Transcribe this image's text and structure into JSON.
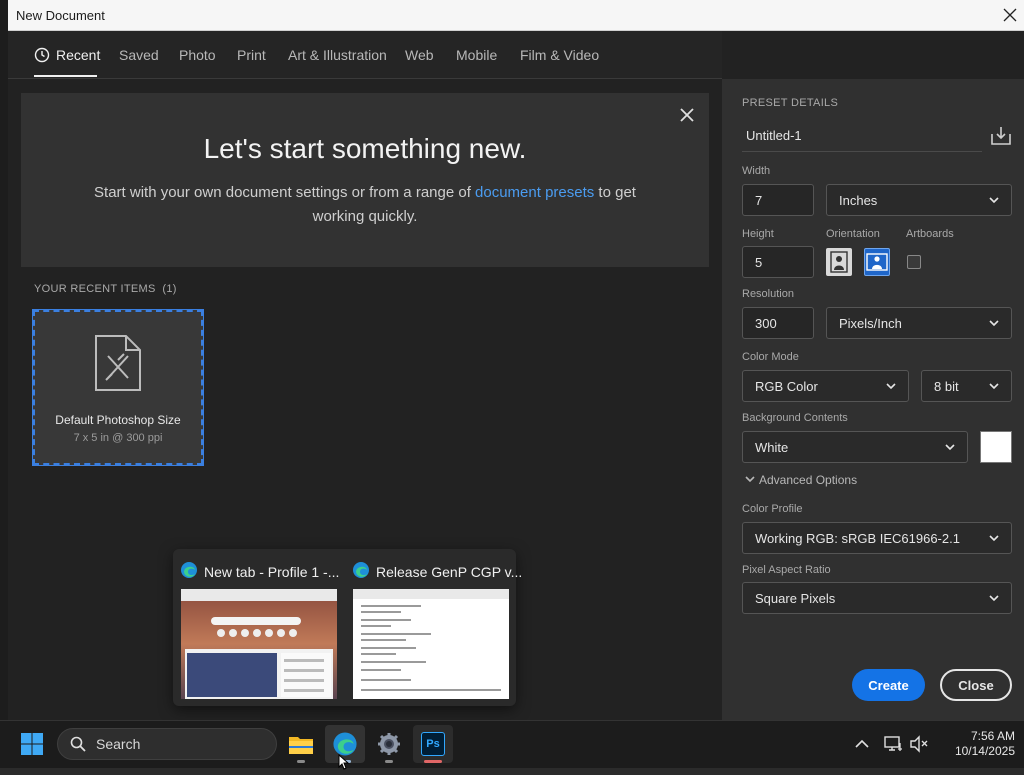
{
  "window": {
    "title": "New Document"
  },
  "tabs": [
    {
      "label": "Recent",
      "active": true
    },
    {
      "label": "Saved"
    },
    {
      "label": "Photo"
    },
    {
      "label": "Print"
    },
    {
      "label": "Art & Illustration"
    },
    {
      "label": "Web"
    },
    {
      "label": "Mobile"
    },
    {
      "label": "Film & Video"
    }
  ],
  "welcome": {
    "heading": "Let's start something new.",
    "sub_before": "Start with your own document settings or from a range of ",
    "sub_link": "document presets",
    "sub_after": " to get working quickly."
  },
  "recent": {
    "label": "YOUR RECENT ITEMS",
    "count": "(1)",
    "items": [
      {
        "name": "Default Photoshop Size",
        "desc": "7 x 5 in @ 300 ppi"
      }
    ]
  },
  "preset": {
    "section_label": "PRESET DETAILS",
    "name": "Untitled-1",
    "width_label": "Width",
    "width_value": "7",
    "width_unit": "Inches",
    "height_label": "Height",
    "height_value": "5",
    "orientation_label": "Orientation",
    "artboards_label": "Artboards",
    "resolution_label": "Resolution",
    "resolution_value": "300",
    "resolution_unit": "Pixels/Inch",
    "color_mode_label": "Color Mode",
    "color_mode": "RGB Color",
    "bit_depth": "8 bit",
    "bg_label": "Background Contents",
    "bg_value": "White",
    "advanced_label": "Advanced Options",
    "color_profile_label": "Color Profile",
    "color_profile": "Working RGB: sRGB IEC61966-2.1",
    "pixel_aspect_label": "Pixel Aspect Ratio",
    "pixel_aspect": "Square Pixels",
    "create_label": "Create",
    "close_label": "Close"
  },
  "taskbar_preview": {
    "windows": [
      {
        "title": "New tab - Profile 1 -..."
      },
      {
        "title": "Release GenP CGP v..."
      }
    ]
  },
  "taskbar": {
    "search_label": "Search",
    "ps_label": "Ps",
    "time": "7:56 AM",
    "date": "10/14/2025"
  },
  "colors": {
    "accent": "#1473e6",
    "link": "#4b9cf0",
    "selected_border": "#3a7fe0"
  }
}
